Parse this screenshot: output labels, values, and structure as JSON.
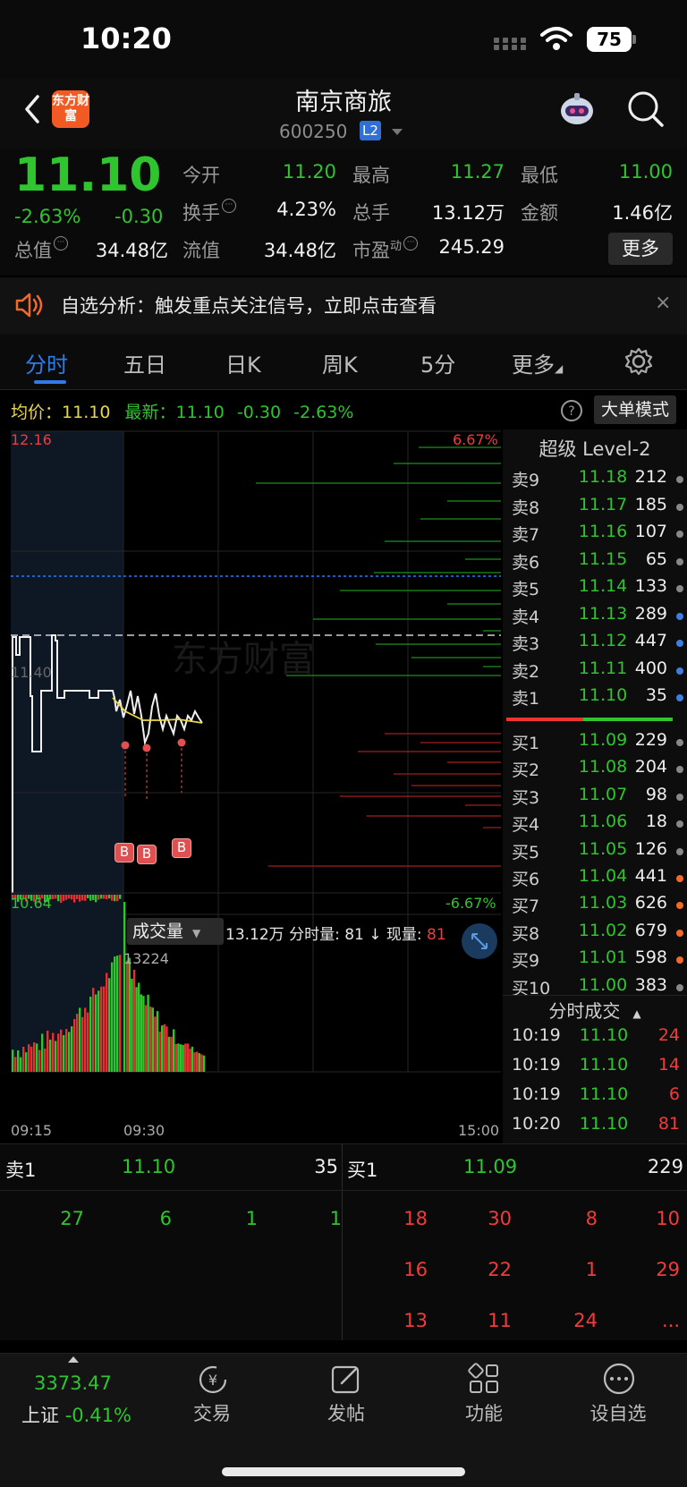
{
  "status_bar": {
    "time": "10:20",
    "battery": "75"
  },
  "header": {
    "logo_text": "东方财富",
    "stock_name": "南京商旅",
    "stock_code": "600250",
    "badge": "L2"
  },
  "quote": {
    "price": "11.10",
    "change_pct": "-2.63%",
    "change": "-0.30",
    "open_label": "今开",
    "open": "11.20",
    "high_label": "最高",
    "high": "11.27",
    "low_label": "最低",
    "low": "11.00",
    "turnover_label": "换手",
    "turnover": "4.23%",
    "volume_label": "总手",
    "volume": "13.12万",
    "amount_label": "金额",
    "amount": "1.46亿",
    "mktcap_label": "总值",
    "mktcap": "34.48亿",
    "float_label": "流值",
    "float": "34.48亿",
    "pe_label": "市盈",
    "pe_sup": "动",
    "pe": "245.29",
    "more": "更多"
  },
  "alert": {
    "text": "自选分析：触发重点关注信号，立即点击查看",
    "close": "×"
  },
  "tabs": [
    "分时",
    "五日",
    "日K",
    "周K",
    "5分",
    "更多"
  ],
  "avg_row": {
    "avg_label": "均价：",
    "avg": "11.10",
    "last_label": "最新：",
    "last": "11.10",
    "chg": "-0.30",
    "chg_pct": "-2.63%",
    "big_order": "大单模式"
  },
  "chart": {
    "top_price": "12.16",
    "bottom_price": "10.64",
    "top_pct": "6.67%",
    "bottom_pct": "-6.67%",
    "mid_price": "11.40",
    "watermark": "东方财富",
    "markers": [
      "B",
      "B",
      "B"
    ],
    "vol_selector": "成交量",
    "vol_info_total": "13.12万",
    "vol_info_label": "分时量: 81",
    "vol_info_now_label": "现量:",
    "vol_info_now": "81",
    "vol_max": "13224",
    "time_start": "09:15",
    "time_mid": "09:30",
    "time_end": "15:00"
  },
  "order_book": {
    "title": "超级 Level-2",
    "asks": [
      {
        "label": "卖9",
        "price": "11.18",
        "vol": "212",
        "dot": "#888"
      },
      {
        "label": "卖8",
        "price": "11.17",
        "vol": "185",
        "dot": "#888"
      },
      {
        "label": "卖7",
        "price": "11.16",
        "vol": "107",
        "dot": "#888"
      },
      {
        "label": "卖6",
        "price": "11.15",
        "vol": "65",
        "dot": "#888"
      },
      {
        "label": "卖5",
        "price": "11.14",
        "vol": "133",
        "dot": "#888"
      },
      {
        "label": "卖4",
        "price": "11.13",
        "vol": "289",
        "dot": "#3d7ee0"
      },
      {
        "label": "卖3",
        "price": "11.12",
        "vol": "447",
        "dot": "#3d7ee0"
      },
      {
        "label": "卖2",
        "price": "11.11",
        "vol": "400",
        "dot": "#3d7ee0"
      },
      {
        "label": "卖1",
        "price": "11.10",
        "vol": "35",
        "dot": "#3d7ee0"
      }
    ],
    "bids": [
      {
        "label": "买1",
        "price": "11.09",
        "vol": "229",
        "dot": "#888"
      },
      {
        "label": "买2",
        "price": "11.08",
        "vol": "204",
        "dot": "#888"
      },
      {
        "label": "买3",
        "price": "11.07",
        "vol": "98",
        "dot": "#888"
      },
      {
        "label": "买4",
        "price": "11.06",
        "vol": "18",
        "dot": "#888"
      },
      {
        "label": "买5",
        "price": "11.05",
        "vol": "126",
        "dot": "#888"
      },
      {
        "label": "买6",
        "price": "11.04",
        "vol": "441",
        "dot": "#f06a2a"
      },
      {
        "label": "买7",
        "price": "11.03",
        "vol": "626",
        "dot": "#f06a2a"
      },
      {
        "label": "买8",
        "price": "11.02",
        "vol": "679",
        "dot": "#f06a2a"
      },
      {
        "label": "买9",
        "price": "11.01",
        "vol": "598",
        "dot": "#f06a2a"
      },
      {
        "label": "买10",
        "price": "11.00",
        "vol": "383",
        "dot": "#888"
      }
    ],
    "trades_title": "分时成交",
    "trades": [
      {
        "time": "10:19",
        "price": "11.10",
        "vol": "24"
      },
      {
        "time": "10:19",
        "price": "11.10",
        "vol": "14"
      },
      {
        "time": "10:19",
        "price": "11.10",
        "vol": "6"
      },
      {
        "time": "10:20",
        "price": "11.10",
        "vol": "81"
      }
    ]
  },
  "bottom_book": {
    "sell_label": "卖1",
    "sell_price": "11.10",
    "sell_vol": "35",
    "buy_label": "买1",
    "buy_price": "11.09",
    "buy_vol": "229",
    "sell_queue": [
      "27",
      "6",
      "1",
      "1"
    ],
    "buy_queue": [
      [
        "18",
        "30",
        "8",
        "10"
      ],
      [
        "16",
        "22",
        "1",
        "29"
      ],
      [
        "13",
        "11",
        "24",
        "..."
      ]
    ]
  },
  "tabbar": {
    "index_value": "3373.47",
    "index_name": "上证",
    "index_chg": "-0.41%",
    "items": [
      "交易",
      "发帖",
      "功能",
      "设自选"
    ]
  },
  "colors": {
    "up": "#f23b3b",
    "down": "#2ec52e",
    "accent": "#2f7bea",
    "brand": "#f15a22"
  }
}
